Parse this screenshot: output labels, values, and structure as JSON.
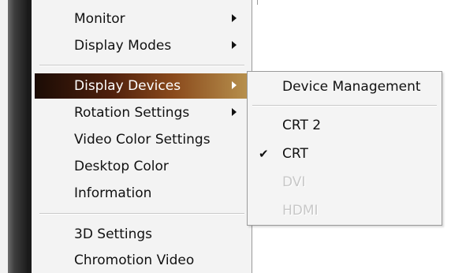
{
  "main_menu": {
    "items": [
      {
        "label": "Monitor",
        "has_submenu": true
      },
      {
        "label": "Display Modes",
        "has_submenu": true
      },
      {
        "label": "Display Devices",
        "has_submenu": true,
        "selected": true
      },
      {
        "label": "Rotation Settings",
        "has_submenu": true
      },
      {
        "label": "Video Color Settings",
        "has_submenu": false
      },
      {
        "label": "Desktop Color",
        "has_submenu": false
      },
      {
        "label": "Information",
        "has_submenu": false
      },
      {
        "label": "3D Settings",
        "has_submenu": false
      },
      {
        "label": "Chromotion Video",
        "has_submenu": false
      }
    ]
  },
  "submenu": {
    "items": [
      {
        "label": "Device Management",
        "enabled": true,
        "checked": false
      },
      {
        "label": "CRT 2",
        "enabled": true,
        "checked": false
      },
      {
        "label": "CRT",
        "enabled": true,
        "checked": true
      },
      {
        "label": "DVI",
        "enabled": false,
        "checked": false
      },
      {
        "label": "HDMI",
        "enabled": false,
        "checked": false
      }
    ]
  },
  "icons": {
    "submenu_arrow": "triangle-right-icon",
    "check_mark": "checkmark-icon"
  },
  "colors": {
    "selected_highlight_start": "#1b0c05",
    "selected_highlight_end": "#b7904d",
    "disabled_text": "#c8c8c8"
  }
}
